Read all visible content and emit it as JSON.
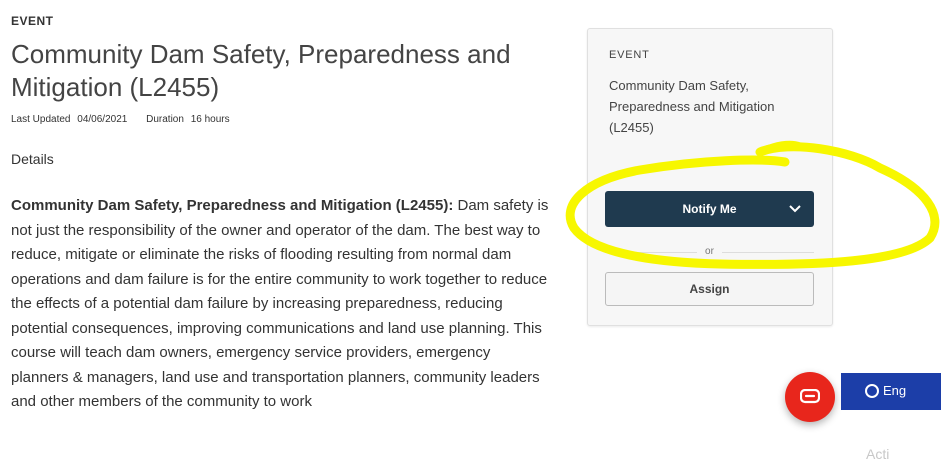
{
  "main": {
    "eyebrow": "EVENT",
    "title": "Community Dam Safety, Preparedness and Mitigation (L2455)",
    "last_updated_label": "Last Updated",
    "last_updated_value": "04/06/2021",
    "duration_label": "Duration",
    "duration_value": "16 hours",
    "details_heading": "Details",
    "body_bold": "Community Dam Safety, Preparedness and Mitigation (L2455):",
    "body_text": " Dam safety is not just the responsibility of the owner and operator of the dam. The best way to reduce, mitigate or eliminate the risks of flooding resulting from normal dam operations and dam failure is for the entire community to work together to reduce the effects of a potential dam failure by increasing preparedness, reducing",
    "body_text2": "potential consequences, improving communications and land use planning. This course will teach dam owners, emergency service providers, emergency planners & managers, land use and transportation planners, community leaders and other members of the community to work"
  },
  "card": {
    "eyebrow": "EVENT",
    "title": "Community Dam Safety, Preparedness and Mitigation (L2455)",
    "notify_label": "Notify Me",
    "or_label": "or",
    "assign_label": "Assign"
  },
  "floating": {
    "language_label": "Eng",
    "faint_text": "Acti"
  },
  "colors": {
    "highlight": "#f7f700",
    "notify_bg": "#1f3a4f",
    "chat_bg": "#e8261c",
    "lang_bg": "#1c3ea8"
  }
}
